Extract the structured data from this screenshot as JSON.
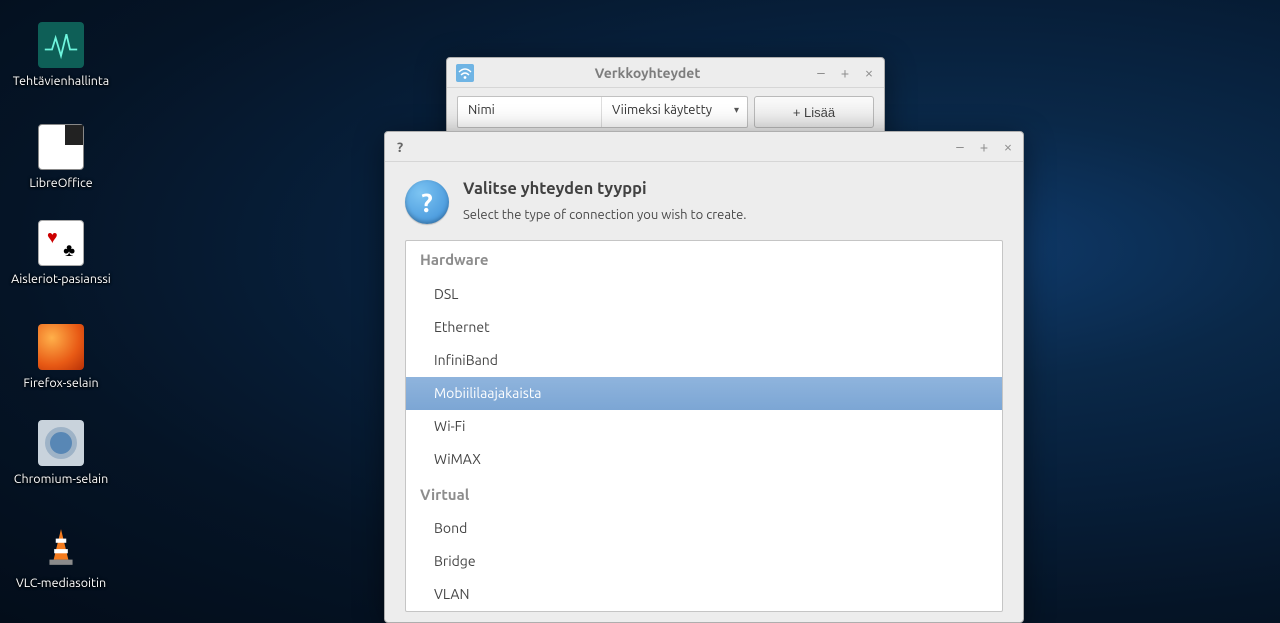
{
  "desktop": {
    "icons": [
      {
        "label": "Tehtävienhallinta"
      },
      {
        "label": "LibreOffice"
      },
      {
        "label": "Aisleriot-pasianssi"
      },
      {
        "label": "Firefox-selain"
      },
      {
        "label": "Chromium-selain"
      },
      {
        "label": "VLC-mediasoitin"
      }
    ]
  },
  "network_window": {
    "title": "Verkkoyhteydet",
    "col_name": "Nimi",
    "col_last_used": "Viimeksi käytetty",
    "add_button": "+ Lisää"
  },
  "dialog": {
    "title": "?",
    "heading": "Valitse yhteyden tyyppi",
    "subtext": "Select the type of connection you wish to create.",
    "groups": [
      {
        "label": "Hardware",
        "items": [
          "DSL",
          "Ethernet",
          "InfiniBand",
          "Mobiililaajakaista",
          "Wi-Fi",
          "WiMAX"
        ]
      },
      {
        "label": "Virtual",
        "items": [
          "Bond",
          "Bridge",
          "VLAN"
        ]
      }
    ],
    "selected": "Mobiililaajakaista"
  }
}
